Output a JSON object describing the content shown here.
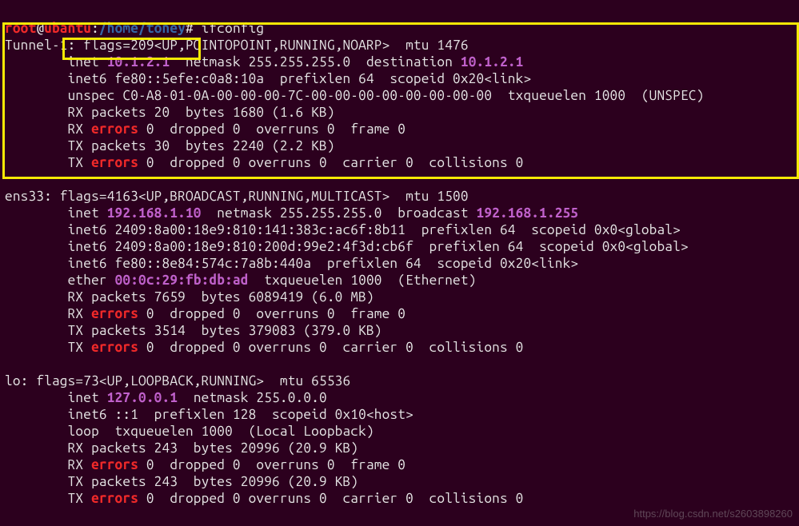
{
  "prompt": {
    "user": "root",
    "at": "@",
    "host": "ubantu",
    "colon": ":",
    "path": "/home/toney",
    "hash": "# ",
    "cmd": "ifconfig"
  },
  "t1": {
    "head": "Tunnel-1: flags=209<UP,POINTOPOINT,RUNNING,NOARP>  mtu 1476",
    "l1a": "        inet ",
    "ip": "10.1.2.1",
    "l1b": "  netmask 255.255.255.0  destination ",
    "dst": "10.1.2.1",
    "l2": "        inet6 fe80::5efe:c0a8:10a  prefixlen 64  scopeid 0x20<link>",
    "l3": "        unspec C0-A8-01-0A-00-00-00-7C-00-00-00-00-00-00-00-00  txqueuelen 1000  (UNSPEC)",
    "l4": "        RX packets 20  bytes 1680 (1.6 KB)",
    "l5a": "        RX ",
    "err": "errors",
    "l5b": " 0  dropped 0  overruns 0  frame 0",
    "l6": "        TX packets 30  bytes 2240 (2.2 KB)",
    "l7a": "        TX ",
    "l7b": " 0  dropped 0 overruns 0  carrier 0  collisions 0"
  },
  "e": {
    "head": "ens33: flags=4163<UP,BROADCAST,RUNNING,MULTICAST>  mtu 1500",
    "l1a": "        inet ",
    "ip": "192.168.1.10",
    "l1b": "  netmask 255.255.255.0  broadcast ",
    "bc": "192.168.1.255",
    "l2": "        inet6 2409:8a00:18e9:810:141:383c:ac6f:8b11  prefixlen 64  scopeid 0x0<global>",
    "l3": "        inet6 2409:8a00:18e9:810:200d:99e2:4f3d:cb6f  prefixlen 64  scopeid 0x0<global>",
    "l4": "        inet6 fe80::8e84:574c:7a8b:440a  prefixlen 64  scopeid 0x20<link>",
    "l5a": "        ether ",
    "mac": "00:0c:29:fb:db:ad",
    "l5b": "  txqueuelen 1000  (Ethernet)",
    "l6": "        RX packets 7659  bytes 6089419 (6.0 MB)",
    "l7a": "        RX ",
    "l7b": " 0  dropped 0  overruns 0  frame 0",
    "l8": "        TX packets 3514  bytes 379083 (379.0 KB)",
    "l9a": "        TX ",
    "l9b": " 0  dropped 0 overruns 0  carrier 0  collisions 0"
  },
  "lo": {
    "head": "lo: flags=73<UP,LOOPBACK,RUNNING>  mtu 65536",
    "l1a": "        inet ",
    "ip": "127.0.0.1",
    "l1b": "  netmask 255.0.0.0",
    "l2": "        inet6 ::1  prefixlen 128  scopeid 0x10<host>",
    "l3": "        loop  txqueuelen 1000  (Local Loopback)",
    "l4": "        RX packets 243  bytes 20996 (20.9 KB)",
    "l5a": "        RX ",
    "l5b": " 0  dropped 0  overruns 0  frame 0",
    "l6": "        TX packets 243  bytes 20996 (20.9 KB)",
    "l7a": "        TX ",
    "l7b": " 0  dropped 0 overruns 0  carrier 0  collisions 0"
  },
  "wm": "https://blog.csdn.net/s2603898260"
}
